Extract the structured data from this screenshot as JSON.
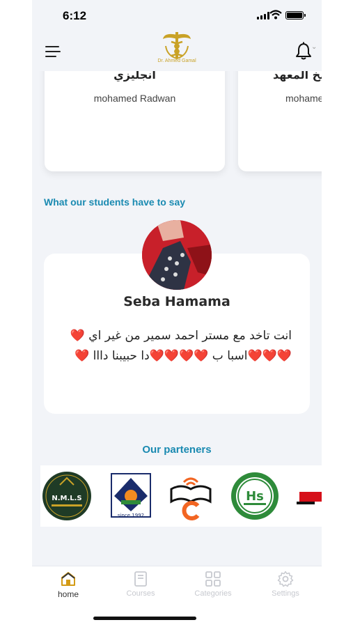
{
  "status": {
    "time": "6:12"
  },
  "header": {
    "logo_text": "Dr. Ahmed Gamal"
  },
  "teachers": [
    {
      "subject": "انجليزي",
      "name": "mohamed Radwan"
    },
    {
      "subject": "يخ المعهد",
      "name": "mohame"
    }
  ],
  "testimonials": {
    "title": "What our students have to say",
    "reviewer": "Seba Hamama",
    "text": "انت تاخد مع مستر احمد سمير من غير اي ❤️❤️❤️❤️اسبا ب ❤️❤️❤️❤️دا حبيبنا دااا ❤️"
  },
  "partners": {
    "title": "Our parteners",
    "logos": [
      {
        "icon": "nmls-logo",
        "text": "N.M.L.S"
      },
      {
        "icon": "institute-logo",
        "text": "since 1992"
      },
      {
        "icon": "book-wifi-c-logo",
        "text": ""
      },
      {
        "icon": "hs-geography-logo",
        "text": "Hs"
      },
      {
        "icon": "red-arabic-logo",
        "text": ""
      }
    ]
  },
  "tabs": [
    {
      "label": "home",
      "icon": "home-icon",
      "active": true
    },
    {
      "label": "Courses",
      "icon": "courses-icon",
      "active": false
    },
    {
      "label": "Categories",
      "icon": "categories-icon",
      "active": false
    },
    {
      "label": "Settings",
      "icon": "settings-icon",
      "active": false
    }
  ],
  "colors": {
    "accent": "#1a8ab1",
    "background": "#f2f4f8",
    "logo_gold": "#c9a227"
  }
}
